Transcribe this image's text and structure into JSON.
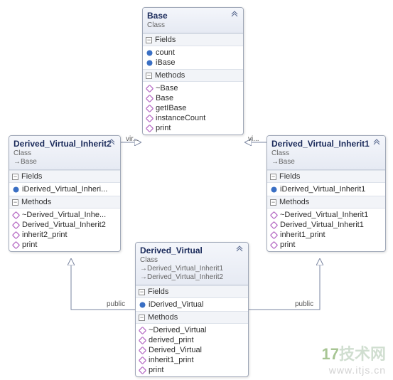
{
  "classes": {
    "base": {
      "name": "Base",
      "stereotype": "Class",
      "inherits": [],
      "fields_label": "Fields",
      "methods_label": "Methods",
      "fields": [
        "count",
        "iBase"
      ],
      "methods": [
        "~Base",
        "Base",
        "getIBase",
        "instanceCount",
        "print"
      ]
    },
    "inherit2": {
      "name": "Derived_Virtual_Inherit2",
      "stereotype": "Class",
      "inherits": [
        "Base"
      ],
      "fields_label": "Fields",
      "methods_label": "Methods",
      "fields": [
        "iDerived_Virtual_Inheri..."
      ],
      "methods": [
        "~Derived_Virtual_Inhe...",
        "Derived_Virtual_Inherit2",
        "inherit2_print",
        "print"
      ]
    },
    "inherit1": {
      "name": "Derived_Virtual_Inherit1",
      "stereotype": "Class",
      "inherits": [
        "Base"
      ],
      "fields_label": "Fields",
      "methods_label": "Methods",
      "fields": [
        "iDerived_Virtual_Inherit1"
      ],
      "methods": [
        "~Derived_Virtual_Inherit1",
        "Derived_Virtual_Inherit1",
        "inherit1_print",
        "print"
      ]
    },
    "derived": {
      "name": "Derived_Virtual",
      "stereotype": "Class",
      "inherits": [
        "Derived_Virtual_Inherit1",
        "Derived_Virtual_Inherit2"
      ],
      "fields_label": "Fields",
      "methods_label": "Methods",
      "fields": [
        "iDerived_Virtual"
      ],
      "methods": [
        "~Derived_Virtual",
        "derived_print",
        "Derived_Virtual",
        "inherit1_print",
        "print"
      ]
    }
  },
  "relations": {
    "virtual_left": "vir...",
    "virtual_right": "vi...",
    "public_left": "public",
    "public_right": "public"
  },
  "watermark": {
    "badge": "17",
    "text": "技术网",
    "url": "www.itjs.cn"
  }
}
